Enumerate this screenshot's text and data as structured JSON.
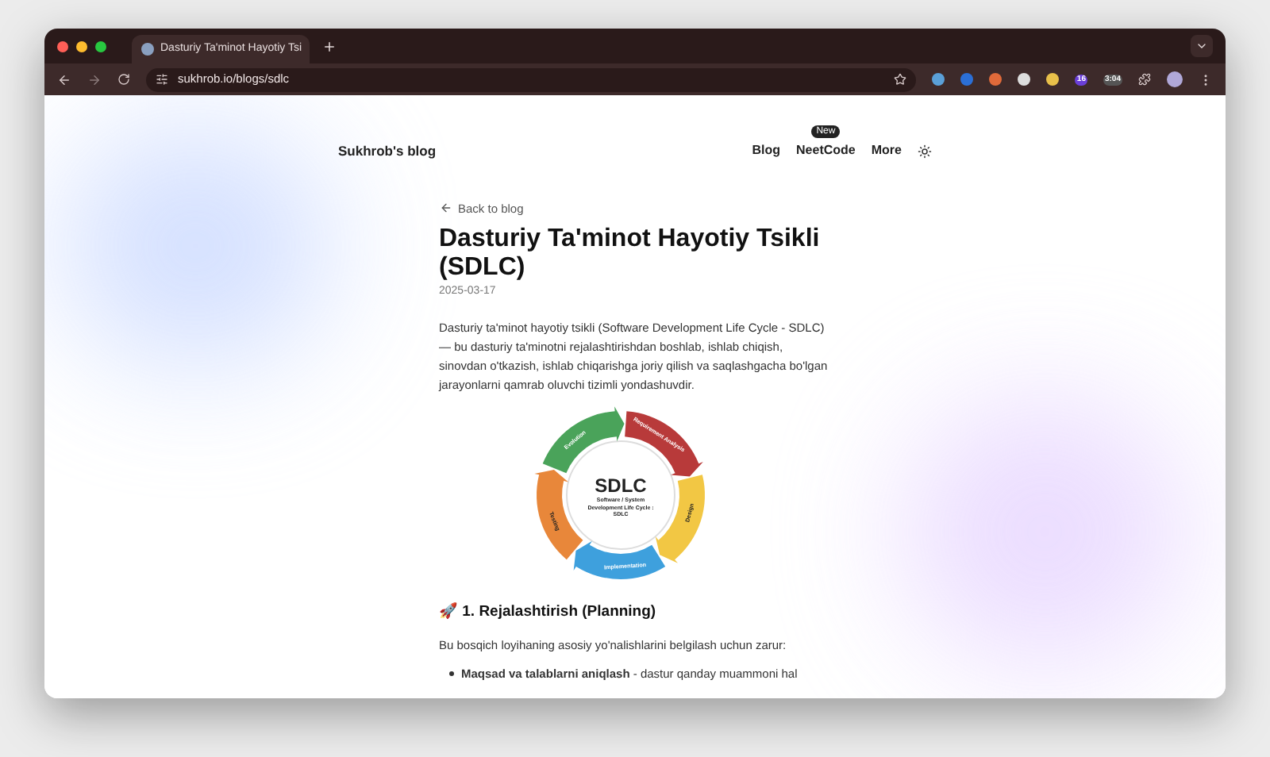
{
  "browser": {
    "tab": {
      "title": "Dasturiy Ta'minot Hayotiy Tsi",
      "selected": true
    },
    "address": "sukhrob.io/blogs/sdlc",
    "extension_badges": [
      {
        "kind": "count",
        "text": "16"
      },
      {
        "kind": "time",
        "text": "3:04"
      }
    ]
  },
  "site": {
    "brand": "Sukhrob's blog",
    "nav": [
      {
        "label": "Blog"
      },
      {
        "label": "NeetCode",
        "badge": "New"
      },
      {
        "label": "More"
      }
    ]
  },
  "article": {
    "back_link": "Back to blog",
    "title": "Dasturiy Ta'minot Hayotiy Tsikli (SDLC)",
    "date": "2025-03-17",
    "intro": "Dasturiy ta'minot hayotiy tsikli (Software Development Life Cycle - SDLC) — bu dasturiy ta'minotni rejalashtirishdan boshlab, ishlab chiqish, sinovdan o'tkazish, ishlab chiqarishga joriy qilish va saqlashgacha bo'lgan jarayonlarni qamrab oluvchi tizimli yondashuvdir.",
    "diagram": {
      "center": "SDLC",
      "subtitle": "Software / System Development Life Cycle : SDLC",
      "stages": [
        {
          "label": "Requirement Analysis",
          "color": "#b83a3a"
        },
        {
          "label": "Design",
          "color": "#f2c744"
        },
        {
          "label": "Implementation",
          "color": "#3ea0dd"
        },
        {
          "label": "Testing",
          "color": "#e8873a"
        },
        {
          "label": "Evolution",
          "color": "#4aa35a"
        }
      ]
    },
    "section_heading": "🚀 1. Rejalashtirish (Planning)",
    "section_text": "Bu bosqich loyihaning asosiy yo'nalishlarini belgilash uchun zarur:",
    "bullets": [
      "**Maqsad va talablarni aniqlash** - dastur qanday muammoni hal"
    ]
  }
}
